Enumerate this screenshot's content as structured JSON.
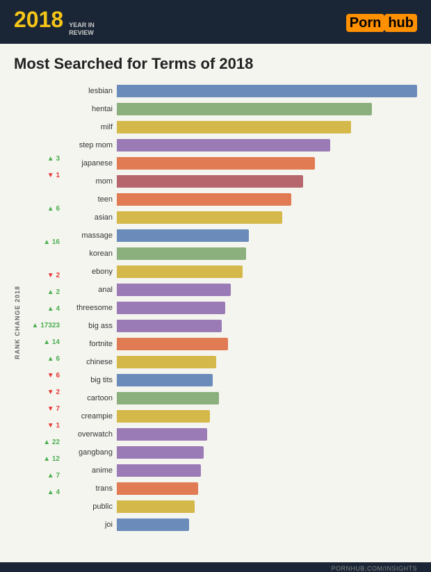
{
  "header": {
    "year": "2018",
    "year_sub_line1": "YEAR IN",
    "year_sub_line2": "REVIEW",
    "logo_text": "Porn",
    "logo_highlight": "hub"
  },
  "title": "Most Searched for Terms of 2018",
  "rank_change_label": "RANK CHANGE 2018",
  "footer_url": "PORNHUB.COM/INSIGHTS",
  "bars": [
    {
      "term": "lesbian",
      "pct": 100,
      "color": "#6b8cba",
      "change": null,
      "dir": null
    },
    {
      "term": "hentai",
      "pct": 85,
      "color": "#8caf7e",
      "change": null,
      "dir": null
    },
    {
      "term": "milf",
      "pct": 78,
      "color": "#d4b84a",
      "change": null,
      "dir": null
    },
    {
      "term": "step mom",
      "pct": 71,
      "color": "#9b7bb5",
      "change": null,
      "dir": null
    },
    {
      "term": "japanese",
      "pct": 66,
      "color": "#e07b54",
      "change": "3",
      "dir": "up"
    },
    {
      "term": "mom",
      "pct": 62,
      "color": "#b5676d",
      "change": "1",
      "dir": "down"
    },
    {
      "term": "teen",
      "pct": 58,
      "color": "#e07b54",
      "change": null,
      "dir": null
    },
    {
      "term": "asian",
      "pct": 55,
      "color": "#d4b84a",
      "change": "6",
      "dir": "up"
    },
    {
      "term": "massage",
      "pct": 44,
      "color": "#6b8cba",
      "change": null,
      "dir": null
    },
    {
      "term": "korean",
      "pct": 43,
      "color": "#8caf7e",
      "change": "16",
      "dir": "up"
    },
    {
      "term": "ebony",
      "pct": 42,
      "color": "#d4b84a",
      "change": null,
      "dir": null
    },
    {
      "term": "anal",
      "pct": 38,
      "color": "#9b7bb5",
      "change": "2",
      "dir": "down"
    },
    {
      "term": "threesome",
      "pct": 36,
      "color": "#9b7bb5",
      "change": "2",
      "dir": "up"
    },
    {
      "term": "big ass",
      "pct": 35,
      "color": "#9b7bb5",
      "change": "4",
      "dir": "up"
    },
    {
      "term": "fortnite",
      "pct": 37,
      "color": "#e07b54",
      "change": "17323",
      "dir": "up"
    },
    {
      "term": "chinese",
      "pct": 33,
      "color": "#d4b84a",
      "change": "14",
      "dir": "up"
    },
    {
      "term": "big tits",
      "pct": 32,
      "color": "#6b8cba",
      "change": "6",
      "dir": "up"
    },
    {
      "term": "cartoon",
      "pct": 34,
      "color": "#8caf7e",
      "change": "6",
      "dir": "down"
    },
    {
      "term": "creampie",
      "pct": 31,
      "color": "#d4b84a",
      "change": "2",
      "dir": "down"
    },
    {
      "term": "overwatch",
      "pct": 30,
      "color": "#9b7bb5",
      "change": "7",
      "dir": "down"
    },
    {
      "term": "gangbang",
      "pct": 29,
      "color": "#9b7bb5",
      "change": "1",
      "dir": "down"
    },
    {
      "term": "anime",
      "pct": 28,
      "color": "#9b7bb5",
      "change": "22",
      "dir": "up"
    },
    {
      "term": "trans",
      "pct": 27,
      "color": "#e07b54",
      "change": "12",
      "dir": "up"
    },
    {
      "term": "public",
      "pct": 26,
      "color": "#d4b84a",
      "change": "7",
      "dir": "up"
    },
    {
      "term": "joi",
      "pct": 24,
      "color": "#6b8cba",
      "change": "4",
      "dir": "up"
    }
  ]
}
